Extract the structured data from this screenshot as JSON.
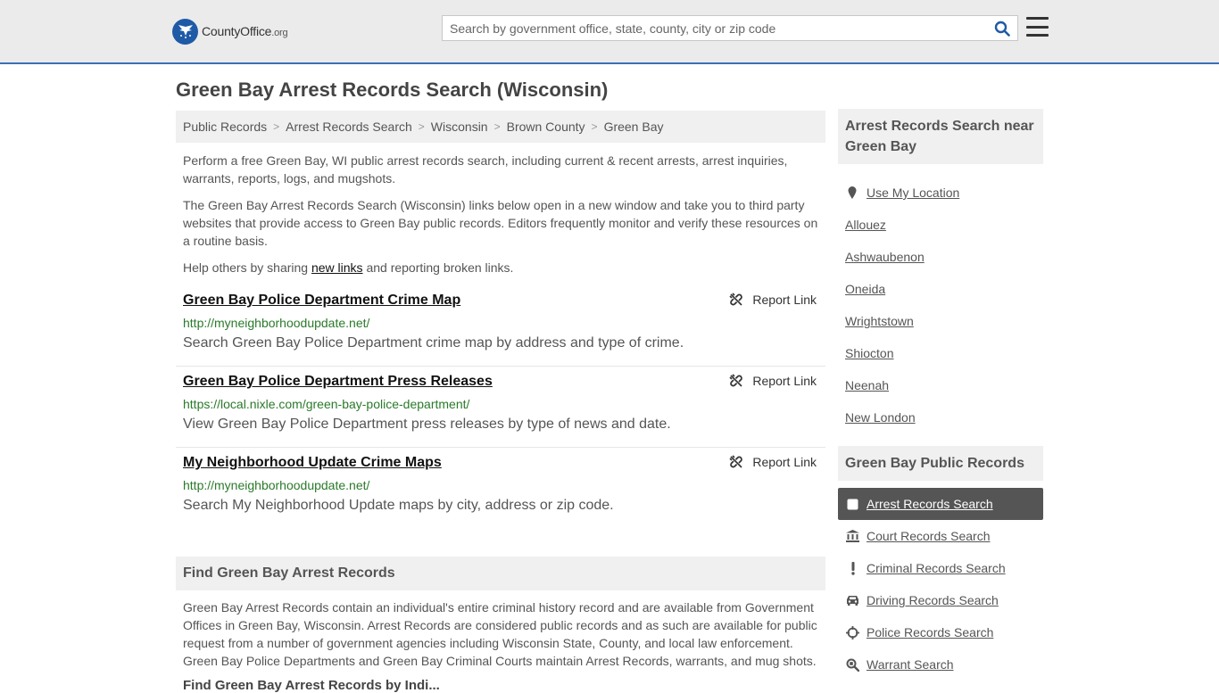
{
  "header": {
    "logo_text_main": "CountyOffice",
    "logo_text_suffix": ".org",
    "search_placeholder": "Search by government office, state, county, city or zip code"
  },
  "page": {
    "title": "Green Bay Arrest Records Search (Wisconsin)"
  },
  "breadcrumb": [
    "Public Records",
    "Arrest Records Search",
    "Wisconsin",
    "Brown County",
    "Green Bay"
  ],
  "intro": {
    "p1": "Perform a free Green Bay, WI public arrest records search, including current & recent arrests, arrest inquiries, warrants, reports, logs, and mugshots.",
    "p2": "The Green Bay Arrest Records Search (Wisconsin) links below open in a new window and take you to third party websites that provide access to Green Bay public records. Editors frequently monitor and verify these resources on a routine basis.",
    "p3_before": "Help others by sharing ",
    "p3_link": "new links",
    "p3_after": " and reporting broken links."
  },
  "results": [
    {
      "title": "Green Bay Police Department Crime Map",
      "url": "http://myneighborhoodupdate.net/",
      "description": "Search Green Bay Police Department crime map by address and type of crime.",
      "report_label": "Report Link"
    },
    {
      "title": "Green Bay Police Department Press Releases",
      "url": "https://local.nixle.com/green-bay-police-department/",
      "description": "View Green Bay Police Department press releases by type of news and date.",
      "report_label": "Report Link"
    },
    {
      "title": "My Neighborhood Update Crime Maps",
      "url": "http://myneighborhoodupdate.net/",
      "description": "Search My Neighborhood Update maps by city, address or zip code.",
      "report_label": "Report Link"
    }
  ],
  "find_section": {
    "heading": "Find Green Bay Arrest Records",
    "body": "Green Bay Arrest Records contain an individual's entire criminal history record and are available from Government Offices in Green Bay, Wisconsin. Arrest Records are considered public records and as such are available for public request from a number of government agencies including Wisconsin State, County, and local law enforcement. Green Bay Police Departments and Green Bay Criminal Courts maintain Arrest Records, warrants, and mug shots.",
    "next_heading_partial": "Find Green Bay Arrest Records by Indi..."
  },
  "sidebar": {
    "near_heading": "Arrest Records Search near Green Bay",
    "use_location": "Use My Location",
    "near_places": [
      "Allouez",
      "Ashwaubenon",
      "Oneida",
      "Wrightstown",
      "Shiocton",
      "Neenah",
      "New London"
    ],
    "public_records_heading": "Green Bay Public Records",
    "public_records": [
      {
        "label": "Arrest Records Search",
        "icon": "square-icon",
        "active": true
      },
      {
        "label": "Court Records Search",
        "icon": "courthouse-icon",
        "active": false
      },
      {
        "label": "Criminal Records Search",
        "icon": "exclamation-icon",
        "active": false
      },
      {
        "label": "Driving Records Search",
        "icon": "car-icon",
        "active": false
      },
      {
        "label": "Police Records Search",
        "icon": "crosshair-icon",
        "active": false
      },
      {
        "label": "Warrant Search",
        "icon": "magnify-icon",
        "active": false
      }
    ]
  },
  "colors": {
    "accent": "#3b6fb6",
    "url_green": "#2a7a2a",
    "active_bg": "#555555"
  }
}
